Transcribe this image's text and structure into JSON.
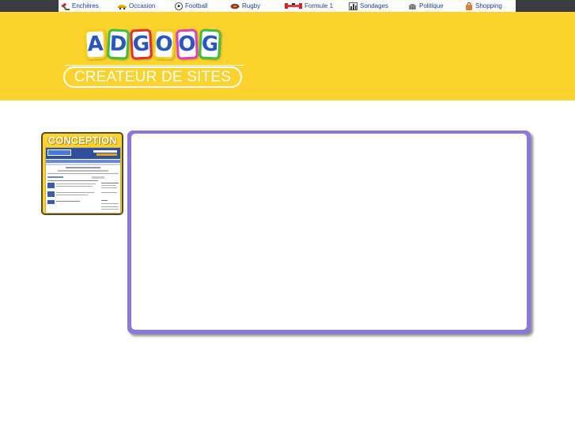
{
  "nav": {
    "items": [
      {
        "label": "Enchères",
        "icon": "auction-icon"
      },
      {
        "label": "Occasion",
        "icon": "car-icon"
      },
      {
        "label": "Football",
        "icon": "soccer-ball-icon"
      },
      {
        "label": "Rugby",
        "icon": "rugby-ball-icon"
      },
      {
        "label": "Formule 1",
        "icon": "f1-car-icon"
      },
      {
        "label": "Sondages",
        "icon": "bar-chart-icon"
      },
      {
        "label": "Politique",
        "icon": "parliament-icon"
      },
      {
        "label": "Shopping",
        "icon": "shopping-bag-icon"
      }
    ]
  },
  "header": {
    "logo_letters": [
      "A",
      "D",
      "G",
      "O",
      "O",
      "G"
    ],
    "logo_colors": [
      "#f0d020",
      "#3fbf3f",
      "#e03030",
      "#f0d020",
      "#e040c0",
      "#3fbf3f"
    ],
    "subtitle": "CREATEUR DE SITES",
    "background": "#fcd22d"
  },
  "sidebar": {
    "conception_label": "CONCEPTION"
  },
  "colors": {
    "frame_border": "#8a78e0",
    "nav_text": "#1d3f8f"
  }
}
